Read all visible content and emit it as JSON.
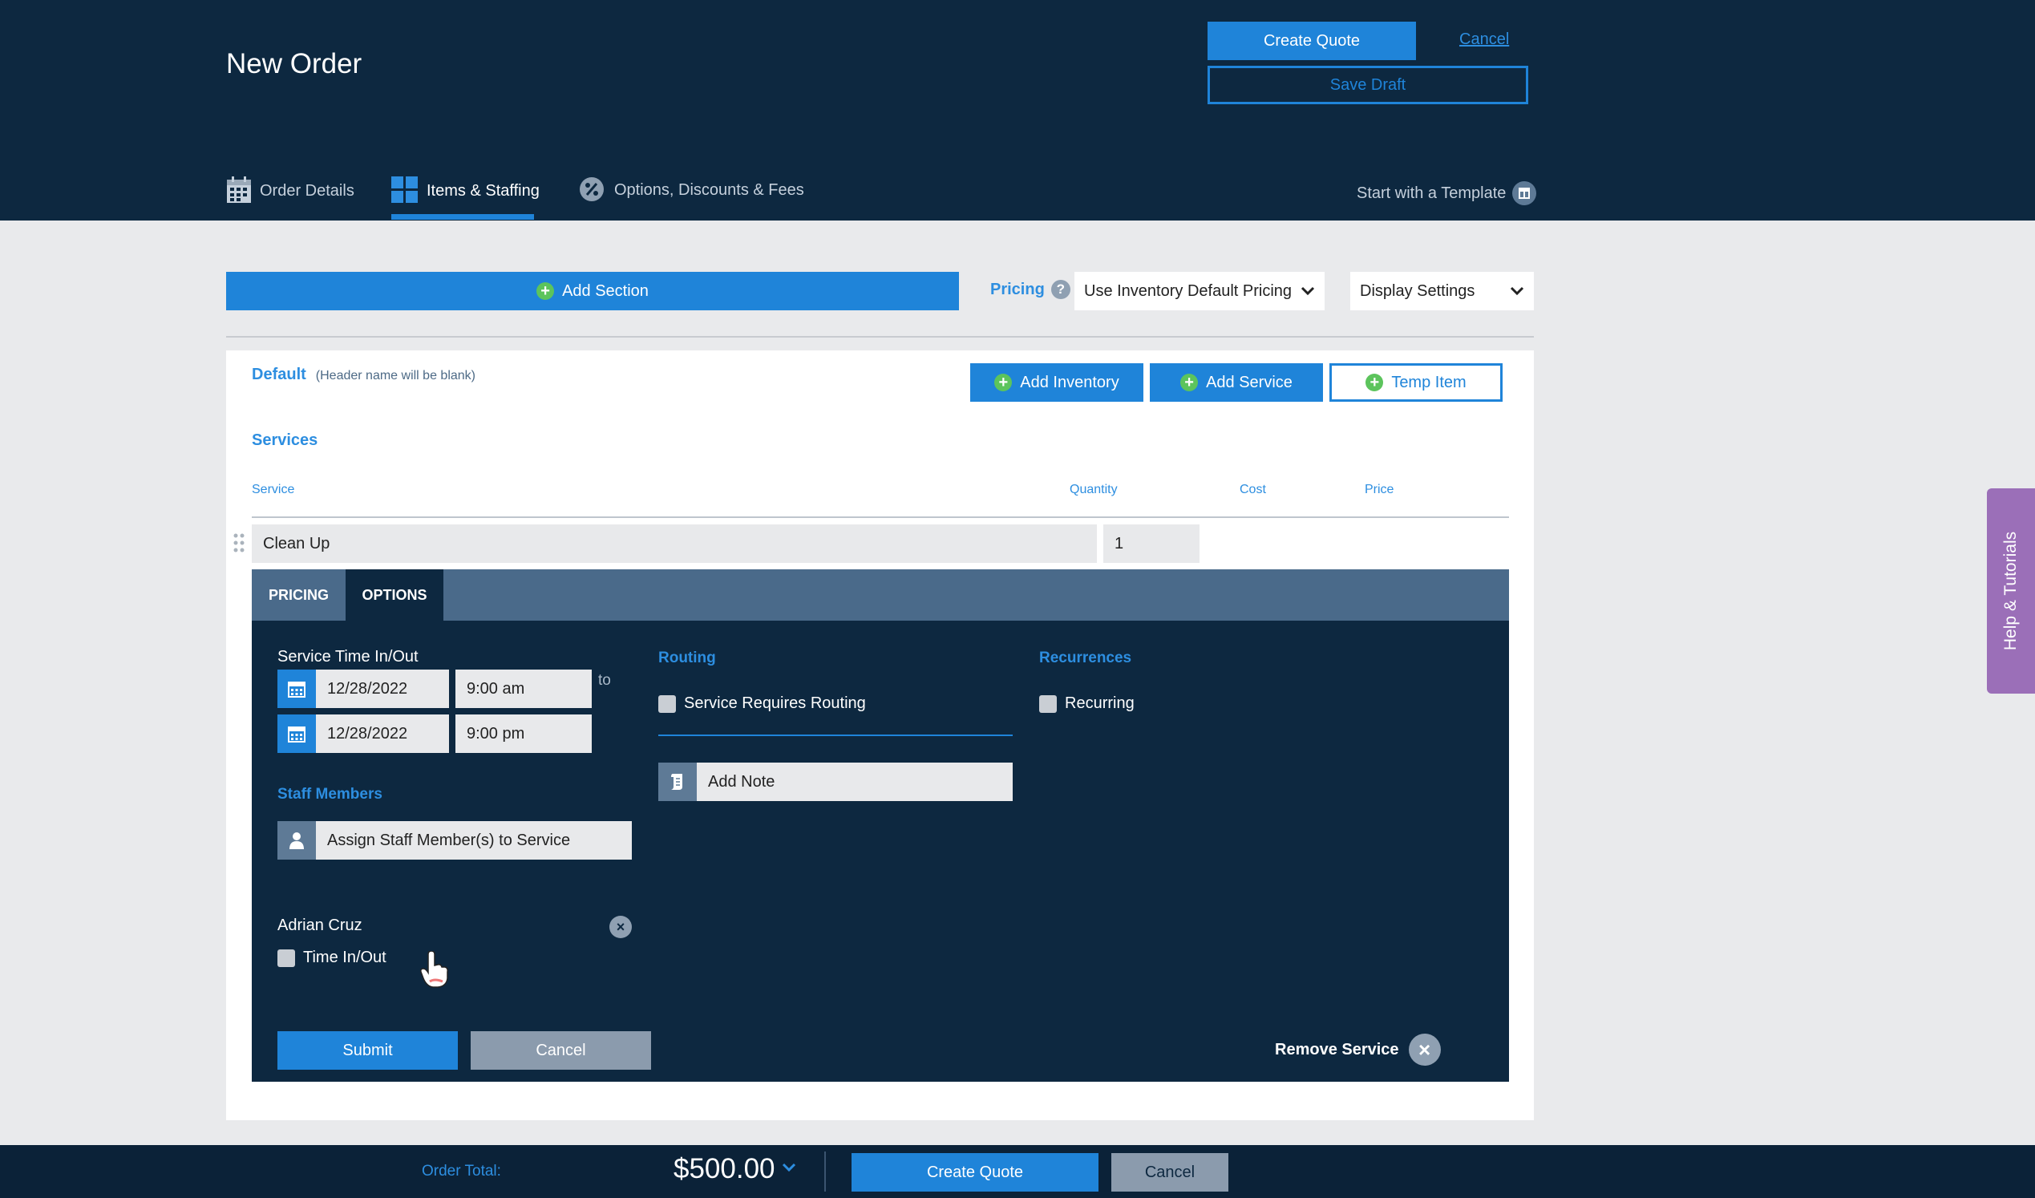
{
  "header": {
    "title": "New Order",
    "create_quote": "Create Quote",
    "cancel": "Cancel",
    "save_draft": "Save Draft",
    "tabs": [
      {
        "label": "Order Details"
      },
      {
        "label": "Items & Staffing"
      },
      {
        "label": "Options, Discounts & Fees"
      }
    ],
    "template_link": "Start with a Template"
  },
  "toolbar": {
    "add_section": "Add Section",
    "pricing_label": "Pricing",
    "pricing_select": "Use Inventory Default Pricing",
    "display_settings": "Display Settings"
  },
  "section": {
    "name": "Default",
    "note": "(Header name will be blank)",
    "add_inventory": "Add Inventory",
    "add_service": "Add Service",
    "temp_item": "Temp Item",
    "services_heading": "Services",
    "columns": [
      "Service",
      "Quantity",
      "Cost",
      "Price"
    ],
    "row": {
      "service": "Clean Up",
      "quantity": "1"
    }
  },
  "panel": {
    "tabs": [
      "PRICING",
      "OPTIONS"
    ],
    "service_time_label": "Service Time In/Out",
    "start_date": "12/28/2022",
    "start_time": "9:00 am",
    "to": "to",
    "end_date": "12/28/2022",
    "end_time": "9:00 pm",
    "staff_heading": "Staff Members",
    "assign_staff": "Assign Staff Member(s) to Service",
    "staff_name": "Adrian Cruz",
    "time_in_out": "Time In/Out",
    "routing_heading": "Routing",
    "requires_routing": "Service Requires Routing",
    "add_note": "Add Note",
    "recurrences_heading": "Recurrences",
    "recurring": "Recurring",
    "submit": "Submit",
    "cancel": "Cancel",
    "remove_service": "Remove Service"
  },
  "side_tab": "Help & Tutorials",
  "footer": {
    "order_total_label": "Order Total:",
    "order_total": "$500.00",
    "create_quote": "Create Quote",
    "cancel": "Cancel"
  },
  "colors": {
    "header_bg": "#0d2840",
    "accent": "#1f84d9",
    "panel_tabbar": "#4a6a8a",
    "help_tab": "#9b6fb8"
  }
}
